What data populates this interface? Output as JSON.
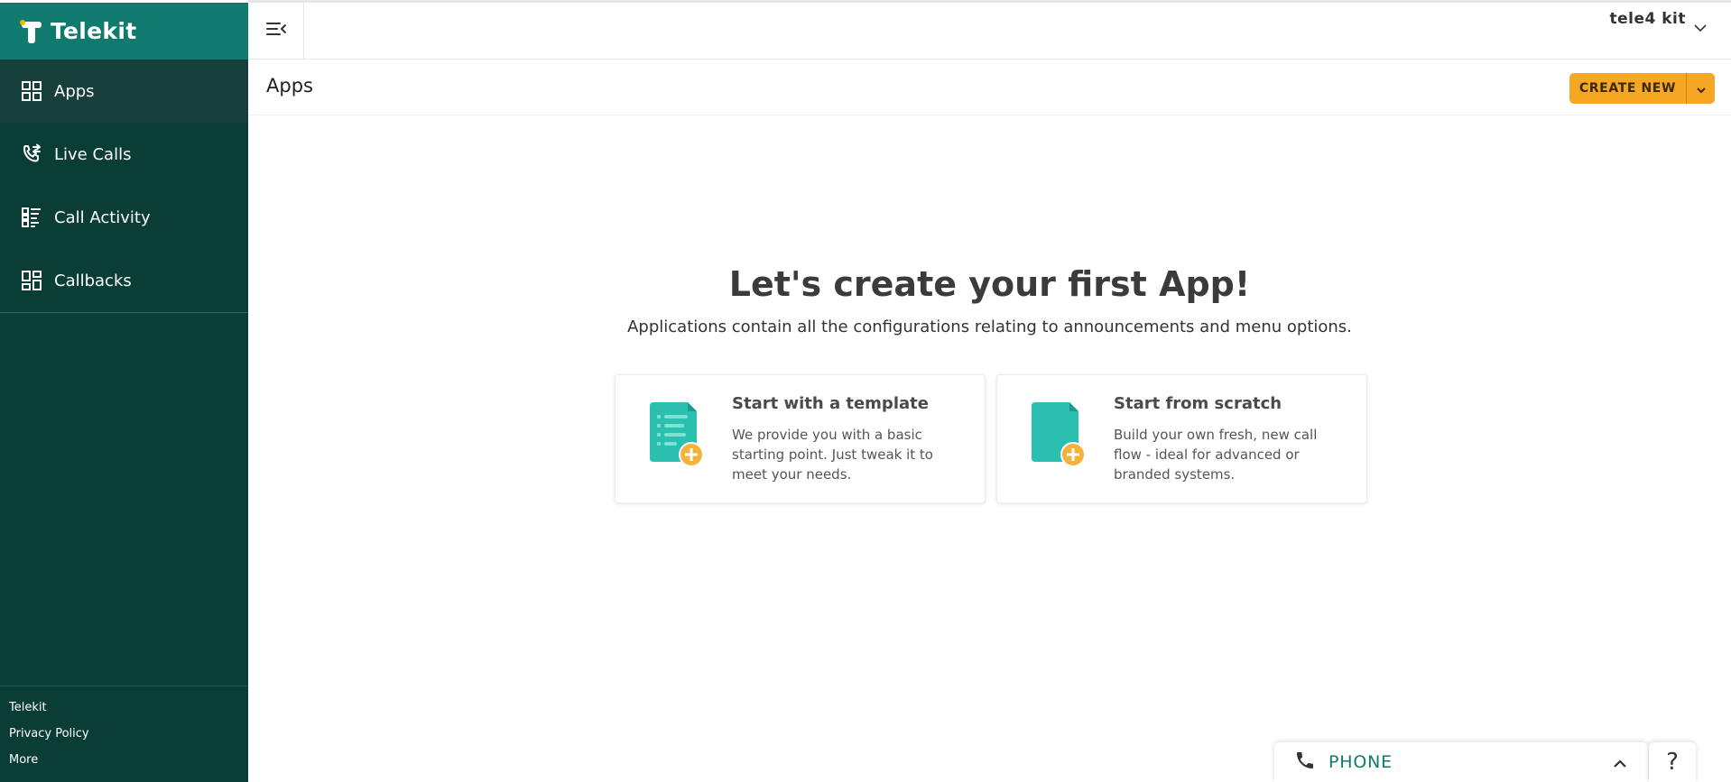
{
  "brand": {
    "name": "Telekit"
  },
  "colors": {
    "sidebar": "#0b3d37",
    "brand_bar": "#0f7a6d",
    "accent": "#f5a623",
    "teal": "#2bbfb0"
  },
  "sidebar": {
    "items": [
      {
        "label": "Apps",
        "icon": "grid-icon",
        "active": true
      },
      {
        "label": "Live Calls",
        "icon": "phone-transfer-icon",
        "active": false
      },
      {
        "label": "Call Activity",
        "icon": "list-icon",
        "active": false
      },
      {
        "label": "Callbacks",
        "icon": "callback-icon",
        "active": false
      }
    ],
    "footer": [
      "Telekit",
      "Privacy Policy",
      "More"
    ]
  },
  "topbar": {
    "menu_icon": "collapse-menu-icon",
    "user_name": "tele4 kit",
    "user_icon": "chevron-down-icon"
  },
  "header": {
    "title": "Apps",
    "create_button": "CREATE NEW"
  },
  "main": {
    "heading": "Let's create your first App!",
    "subheading": "Applications contain all the configurations relating to announcements and menu options.",
    "cards": [
      {
        "title": "Start with a template",
        "description": "We provide you with a basic starting point. Just tweak it to meet your needs.",
        "icon": "template-document-plus-icon"
      },
      {
        "title": "Start from scratch",
        "description": "Build your own fresh, new call flow - ideal for advanced or branded systems.",
        "icon": "blank-document-plus-icon"
      }
    ]
  },
  "phone_widget": {
    "label": "PHONE",
    "icon": "phone-icon",
    "toggle_icon": "chevron-up-icon"
  },
  "help": {
    "label": "?"
  }
}
